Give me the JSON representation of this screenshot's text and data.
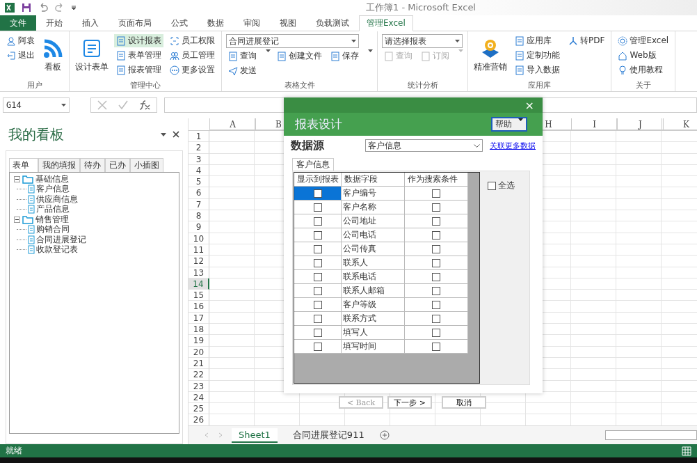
{
  "window": {
    "title": "工作簿1 - Microsoft Excel"
  },
  "ribbon_tabs": [
    {
      "label": "文件",
      "kind": "file",
      "selected": false
    },
    {
      "label": "开始",
      "kind": "tab",
      "selected": false
    },
    {
      "label": "插入",
      "kind": "tab",
      "selected": false
    },
    {
      "label": "页面布局",
      "kind": "tab",
      "selected": false
    },
    {
      "label": "公式",
      "kind": "tab",
      "selected": false
    },
    {
      "label": "数据",
      "kind": "tab",
      "selected": false
    },
    {
      "label": "审阅",
      "kind": "tab",
      "selected": false
    },
    {
      "label": "视图",
      "kind": "tab",
      "selected": false
    },
    {
      "label": "负载测试",
      "kind": "tab",
      "selected": false
    },
    {
      "label": "管理Excel",
      "kind": "tab",
      "selected": true
    }
  ],
  "ribbon": {
    "user": {
      "label": "用户",
      "items": [
        {
          "label": "阿袁"
        },
        {
          "label": "退出"
        }
      ],
      "large": "看板"
    },
    "management": {
      "label": "管理中心",
      "large": "设计表单",
      "column_1": [
        {
          "label": "设计报表",
          "selected": true
        },
        {
          "label": "表单管理",
          "selected": false
        },
        {
          "label": "报表管理",
          "selected": false
        }
      ],
      "column_2": [
        {
          "label": "员工权限",
          "selected": false
        },
        {
          "label": "员工管理",
          "selected": false
        },
        {
          "label": "更多设置",
          "selected": false
        }
      ]
    },
    "files": {
      "label": "表格文件",
      "dropdown": "合同进展登记",
      "row_1": [
        {
          "label": "查询",
          "has_menu": true
        },
        {
          "label": "创建文件",
          "has_menu": false
        },
        {
          "label": "保存",
          "has_menu": true
        }
      ],
      "row_2": [
        {
          "label": "发送",
          "has_menu": false
        }
      ]
    },
    "stats": {
      "label": "统计分析",
      "placeholder": "请选择报表",
      "items": [
        {
          "label": "查询",
          "disabled": true,
          "has_menu": false
        },
        {
          "label": "订阅",
          "disabled": true,
          "has_menu": true
        }
      ]
    },
    "apps": {
      "label": "应用库",
      "large": "精准营销",
      "column_1": [
        "应用库",
        "定制功能",
        "导入数据"
      ],
      "column_2": [
        "转PDF"
      ]
    },
    "about": {
      "label": "关于",
      "items": [
        "管理Excel",
        "Web版",
        "使用教程"
      ]
    }
  },
  "formula_bar": {
    "name_box": "G14"
  },
  "pane": {
    "title": "我的看板",
    "tabs": [
      {
        "label": "表单",
        "selected": true
      },
      {
        "label": "我的填报",
        "selected": false
      },
      {
        "label": "待办",
        "selected": false
      },
      {
        "label": "已办",
        "selected": false
      },
      {
        "label": "小插图",
        "selected": false
      }
    ],
    "tree": [
      {
        "label": "基础信息",
        "expanded": true,
        "children": [
          {
            "label": "客户信息"
          },
          {
            "label": "供应商信息"
          },
          {
            "label": "产品信息"
          }
        ]
      },
      {
        "label": "销售管理",
        "expanded": true,
        "children": [
          {
            "label": "购销合同"
          },
          {
            "label": "合同进展登记"
          },
          {
            "label": "收款登记表"
          }
        ]
      }
    ]
  },
  "grid": {
    "columns_left": [
      "A",
      "B"
    ],
    "columns_right": [
      "H",
      "I",
      "J",
      "K"
    ],
    "rows": [
      {
        "label": "1",
        "selected": false
      },
      {
        "label": "2",
        "selected": false
      },
      {
        "label": "3",
        "selected": false
      },
      {
        "label": "4",
        "selected": false
      },
      {
        "label": "5",
        "selected": false
      },
      {
        "label": "6",
        "selected": false
      },
      {
        "label": "7",
        "selected": false
      },
      {
        "label": "8",
        "selected": false
      },
      {
        "label": "9",
        "selected": false
      },
      {
        "label": "10",
        "selected": false
      },
      {
        "label": "11",
        "selected": false
      },
      {
        "label": "12",
        "selected": false
      },
      {
        "label": "13",
        "selected": false
      },
      {
        "label": "14",
        "selected": true
      },
      {
        "label": "15",
        "selected": false
      },
      {
        "label": "16",
        "selected": false
      },
      {
        "label": "17",
        "selected": false
      },
      {
        "label": "18",
        "selected": false
      },
      {
        "label": "19",
        "selected": false
      },
      {
        "label": "20",
        "selected": false
      },
      {
        "label": "21",
        "selected": false
      },
      {
        "label": "22",
        "selected": false
      },
      {
        "label": "23",
        "selected": false
      },
      {
        "label": "24",
        "selected": false
      },
      {
        "label": "25",
        "selected": false
      },
      {
        "label": "26",
        "selected": false
      }
    ]
  },
  "sheet_tabs": [
    {
      "label": "Sheet1",
      "selected": true
    },
    {
      "label": "合同进展登记911",
      "selected": false
    }
  ],
  "status_bar": {
    "text": "就绪"
  },
  "dialog": {
    "title": "报表设计",
    "close": "×",
    "help": "帮助",
    "source_label": "数据源",
    "source_value": "客户信息",
    "link": "关联更多数据",
    "tabs": [
      {
        "label": "客户信息",
        "selected": true
      }
    ],
    "columns": [
      "显示到报表",
      "数据字段",
      "作为搜索条件"
    ],
    "rows": [
      {
        "field": "客户编号",
        "show": false,
        "search": false,
        "selected": true
      },
      {
        "field": "客户名称",
        "show": false,
        "search": false,
        "selected": false
      },
      {
        "field": "公司地址",
        "show": false,
        "search": false,
        "selected": false
      },
      {
        "field": "公司电话",
        "show": false,
        "search": false,
        "selected": false
      },
      {
        "field": "公司传真",
        "show": false,
        "search": false,
        "selected": false
      },
      {
        "field": "联系人",
        "show": false,
        "search": false,
        "selected": false
      },
      {
        "field": "联系电话",
        "show": false,
        "search": false,
        "selected": false
      },
      {
        "field": "联系人邮箱",
        "show": false,
        "search": false,
        "selected": false
      },
      {
        "field": "客户等级",
        "show": false,
        "search": false,
        "selected": false
      },
      {
        "field": "联系方式",
        "show": false,
        "search": false,
        "selected": false
      },
      {
        "field": "填写人",
        "show": false,
        "search": false,
        "selected": false
      },
      {
        "field": "填写时间",
        "show": false,
        "search": false,
        "selected": false
      }
    ],
    "select_all": {
      "label": "全选",
      "checked": false
    },
    "buttons": [
      {
        "label": "< Back",
        "disabled": true
      },
      {
        "label": "下一步 >",
        "disabled": false
      },
      {
        "label": "取消",
        "disabled": false
      }
    ]
  }
}
